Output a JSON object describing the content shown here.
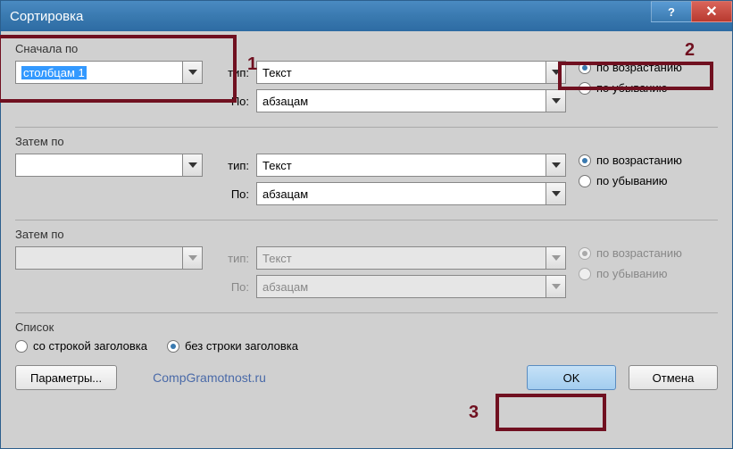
{
  "window": {
    "title": "Сортировка"
  },
  "annotations": {
    "n1": "1",
    "n2": "2",
    "n3": "3"
  },
  "sort1": {
    "label": "Сначала по",
    "field": "столбцам 1",
    "type_label": "тип:",
    "type_value": "Текст",
    "by_label": "По:",
    "by_value": "абзацам",
    "asc": "по возрастанию",
    "desc": "по убыванию"
  },
  "sort2": {
    "label": "Затем по",
    "field": "",
    "type_label": "тип:",
    "type_value": "Текст",
    "by_label": "По:",
    "by_value": "абзацам",
    "asc": "по возрастанию",
    "desc": "по убыванию"
  },
  "sort3": {
    "label": "Затем по",
    "field": "",
    "type_label": "тип:",
    "type_value": "Текст",
    "by_label": "По:",
    "by_value": "абзацам",
    "asc": "по возрастанию",
    "desc": "по убыванию"
  },
  "list": {
    "label": "Список",
    "with_header": "со строкой заголовка",
    "without_header": "без строки заголовка"
  },
  "buttons": {
    "params": "Параметры...",
    "ok": "OK",
    "cancel": "Отмена"
  },
  "watermark": "CompGramotnost.ru"
}
